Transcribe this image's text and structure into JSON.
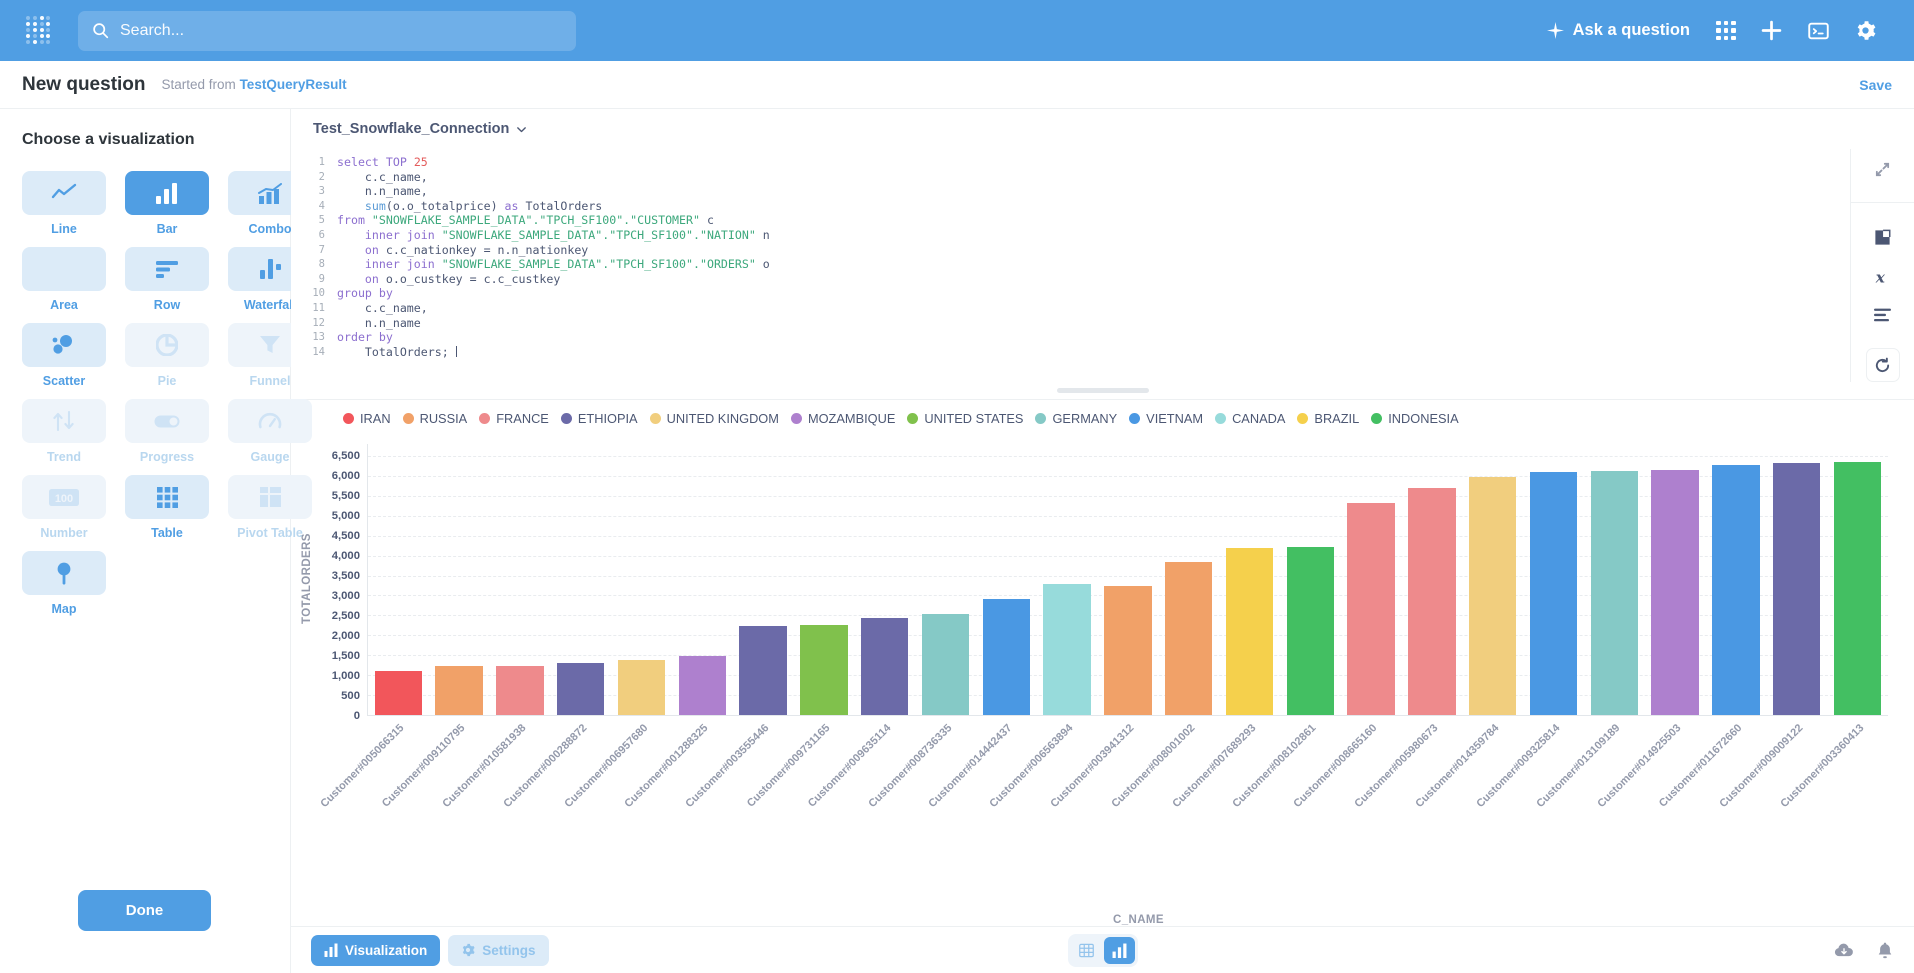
{
  "topnav": {
    "search_placeholder": "Search...",
    "ask_label": "Ask a question",
    "icons": [
      "grid-apps-icon",
      "plus-icon",
      "sql-console-icon",
      "gear-icon"
    ]
  },
  "subheader": {
    "title": "New question",
    "started_prefix": "Started from",
    "started_source": "TestQueryResult",
    "save_label": "Save"
  },
  "sidebar": {
    "heading": "Choose a visualization",
    "done_label": "Done",
    "items": [
      {
        "label": "Line",
        "icon": "line-chart-icon",
        "state": "enabled"
      },
      {
        "label": "Bar",
        "icon": "bar-chart-icon",
        "state": "selected"
      },
      {
        "label": "Combo",
        "icon": "combo-chart-icon",
        "state": "enabled"
      },
      {
        "label": "Area",
        "icon": "area-chart-icon",
        "state": "enabled"
      },
      {
        "label": "Row",
        "icon": "row-chart-icon",
        "state": "enabled"
      },
      {
        "label": "Waterfall",
        "icon": "waterfall-icon",
        "state": "enabled"
      },
      {
        "label": "Scatter",
        "icon": "scatter-icon",
        "state": "enabled"
      },
      {
        "label": "Pie",
        "icon": "pie-chart-icon",
        "state": "disabled"
      },
      {
        "label": "Funnel",
        "icon": "funnel-icon",
        "state": "disabled"
      },
      {
        "label": "Trend",
        "icon": "trend-icon",
        "state": "disabled"
      },
      {
        "label": "Progress",
        "icon": "progress-icon",
        "state": "disabled"
      },
      {
        "label": "Gauge",
        "icon": "gauge-icon",
        "state": "disabled"
      },
      {
        "label": "Number",
        "icon": "number-icon",
        "state": "disabled"
      },
      {
        "label": "Table",
        "icon": "table-icon",
        "state": "enabled"
      },
      {
        "label": "Pivot Table",
        "icon": "pivot-table-icon",
        "state": "disabled"
      },
      {
        "label": "Map",
        "icon": "map-pin-icon",
        "state": "enabled"
      }
    ]
  },
  "editor": {
    "connection": "Test_Snowflake_Connection",
    "lines": [
      {
        "n": 1,
        "html": "<span class='kw'>select</span> <span class='kw'>TOP</span> <span class='num'>25</span>"
      },
      {
        "n": 2,
        "html": "    c.c_name,"
      },
      {
        "n": 3,
        "html": "    n.n_name,"
      },
      {
        "n": 4,
        "html": "    <span class='fn'>sum</span>(o.o_totalprice) <span class='kw'>as</span> TotalOrders"
      },
      {
        "n": 5,
        "html": "<span class='kw'>from</span> <span class='str'>\"SNOWFLAKE_SAMPLE_DATA\".\"TPCH_SF100\".\"CUSTOMER\"</span> c"
      },
      {
        "n": 6,
        "html": "    <span class='kw'>inner join</span> <span class='str'>\"SNOWFLAKE_SAMPLE_DATA\".\"TPCH_SF100\".\"NATION\"</span> n"
      },
      {
        "n": 7,
        "html": "    <span class='kw'>on</span> c.c_nationkey = n.n_nationkey"
      },
      {
        "n": 8,
        "html": "    <span class='kw'>inner join</span> <span class='str'>\"SNOWFLAKE_SAMPLE_DATA\".\"TPCH_SF100\".\"ORDERS\"</span> o"
      },
      {
        "n": 9,
        "html": "    <span class='kw'>on</span> o.o_custkey = c.c_custkey"
      },
      {
        "n": 10,
        "html": "<span class='kw'>group by</span>"
      },
      {
        "n": 11,
        "html": "    c.c_name,"
      },
      {
        "n": 12,
        "html": "    n.n_name"
      },
      {
        "n": 13,
        "html": "<span class='kw'>order by</span>"
      },
      {
        "n": 14,
        "html": "    TotalOrders; <span class='caret'></span>"
      }
    ],
    "rail_icons": [
      "collapse-icon",
      "data-reference-icon",
      "variables-icon",
      "format-icon",
      "run-query-icon"
    ]
  },
  "bottombar": {
    "visualization_label": "Visualization",
    "settings_label": "Settings",
    "toggle": [
      "table-view-icon",
      "chart-view-icon"
    ],
    "right_icons": [
      "download-icon",
      "alert-bell-icon"
    ]
  },
  "chart_data": {
    "type": "bar",
    "title": "",
    "xlabel": "C_NAME",
    "ylabel": "TOTALORDERS",
    "ylim": [
      0,
      6800
    ],
    "yticks": [
      0,
      500,
      1000,
      1500,
      2000,
      2500,
      3000,
      3500,
      4000,
      4500,
      5000,
      5500,
      6000,
      6500
    ],
    "ytick_labels": [
      "0",
      "500",
      "1,000",
      "1,500",
      "2,000",
      "2,500",
      "3,000",
      "3,500",
      "4,000",
      "4,500",
      "5,000",
      "5,500",
      "6,000",
      "6,500"
    ],
    "grid": true,
    "legend_position": "top",
    "legend": [
      {
        "label": "IRAN",
        "color": "#F2565B"
      },
      {
        "label": "RUSSIA",
        "color": "#F1A168"
      },
      {
        "label": "FRANCE",
        "color": "#EE8A8C"
      },
      {
        "label": "ETHIOPIA",
        "color": "#6B6AA8"
      },
      {
        "label": "UNITED KINGDOM",
        "color": "#F1CE7E"
      },
      {
        "label": "MOZAMBIQUE",
        "color": "#AE80CE"
      },
      {
        "label": "UNITED STATES",
        "color": "#80C14C"
      },
      {
        "label": "GERMANY",
        "color": "#85C9C6"
      },
      {
        "label": "VIETNAM",
        "color": "#4A98E3"
      },
      {
        "label": "CANADA",
        "color": "#97DBDB"
      },
      {
        "label": "BRAZIL",
        "color": "#F5D04C"
      },
      {
        "label": "INDONESIA",
        "color": "#43BF62"
      }
    ],
    "categories": [
      "Customer#005066315",
      "Customer#009110795",
      "Customer#010581938",
      "Customer#000288872",
      "Customer#006957680",
      "Customer#001288325",
      "Customer#003555446",
      "Customer#009731165",
      "Customer#009635114",
      "Customer#008736335",
      "Customer#014442437",
      "Customer#006563894",
      "Customer#003941312",
      "Customer#008001002",
      "Customer#007689293",
      "Customer#008102861",
      "Customer#008665160",
      "Customer#005980673",
      "Customer#014359784",
      "Customer#009325814",
      "Customer#013109189",
      "Customer#014925503",
      "Customer#011672660",
      "Customer#009009122",
      "Customer#003360413"
    ],
    "values": [
      1100,
      1220,
      1240,
      1310,
      1370,
      1470,
      2230,
      2250,
      2430,
      2530,
      2920,
      3280,
      3230,
      3850,
      4200,
      4210,
      5320,
      5700,
      5970,
      6090,
      6130,
      6160,
      6280,
      6320,
      6350
    ],
    "bar_colors": [
      "#F2565B",
      "#F1A168",
      "#EE8A8C",
      "#6B6AA8",
      "#F1CE7E",
      "#AE80CE",
      "#6B6AA8",
      "#80C14C",
      "#6B6AA8",
      "#85C9C6",
      "#4A98E3",
      "#97DBDB",
      "#F1A168",
      "#F1A168",
      "#F5D04C",
      "#43BF62",
      "#EE8A8C",
      "#EE8A8C",
      "#F1CE7E",
      "#4A98E3",
      "#85C9C6",
      "#AE80CE",
      "#4A98E3",
      "#6B6AA8",
      "#43BF62"
    ]
  }
}
